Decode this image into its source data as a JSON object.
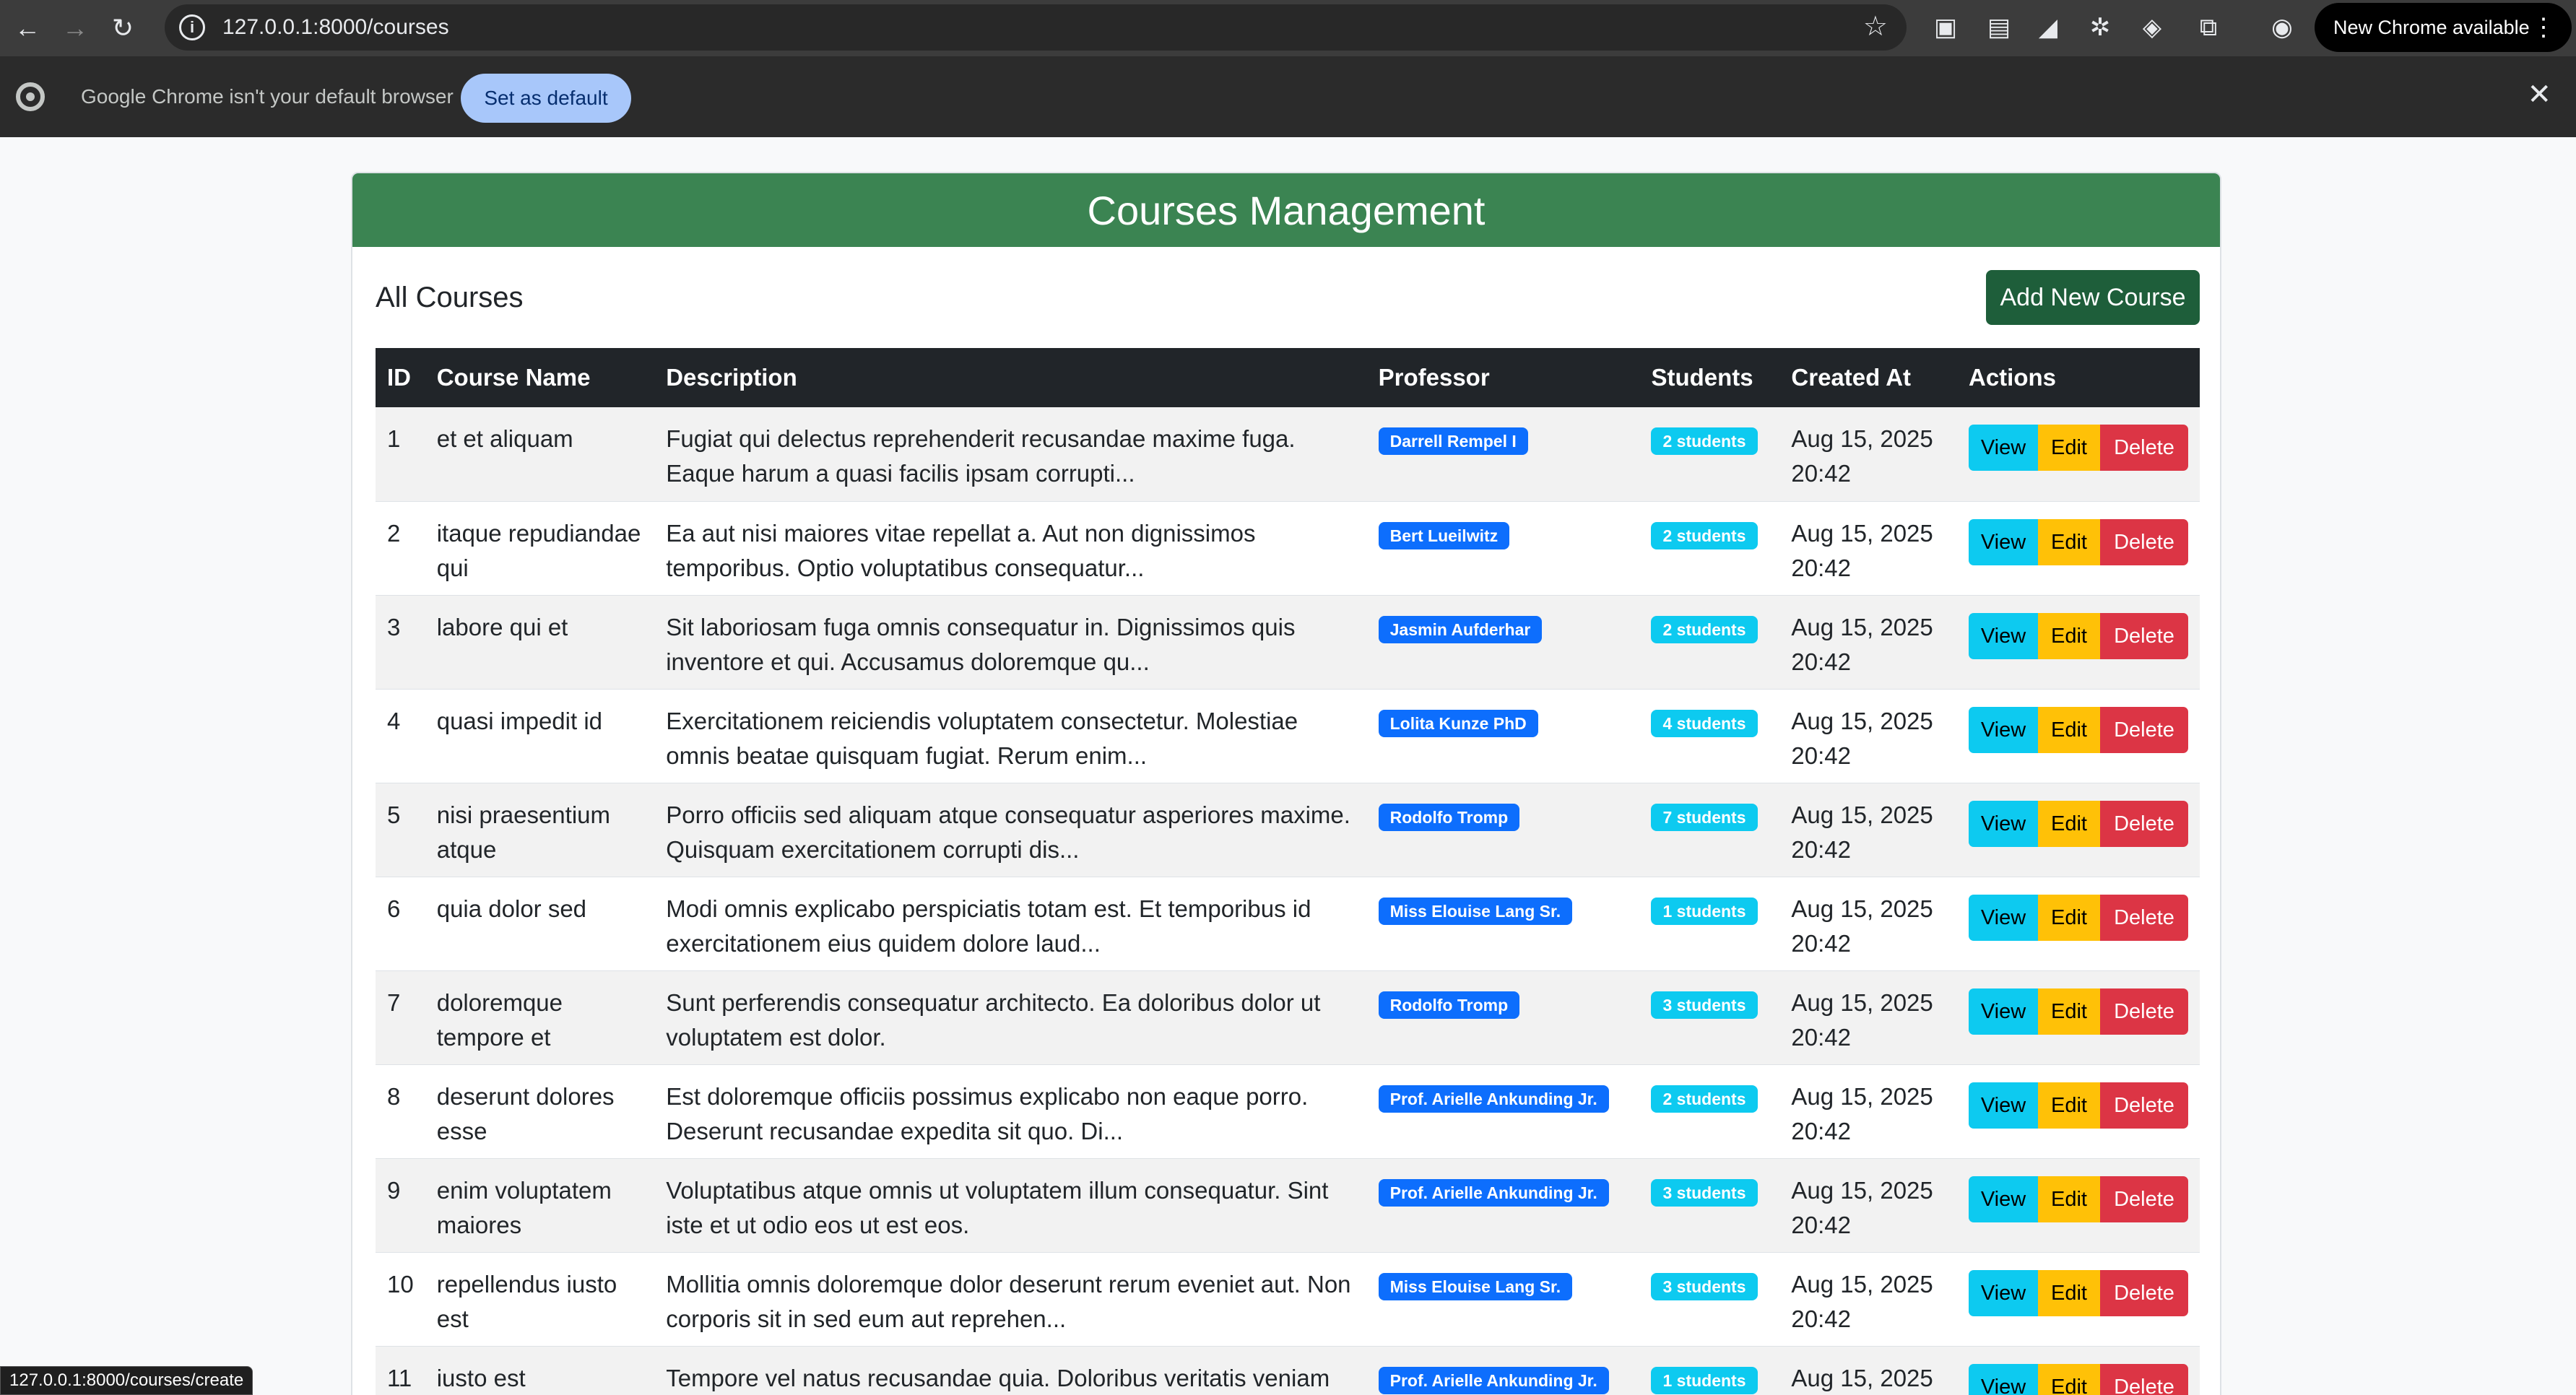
{
  "browser": {
    "url": "127.0.0.1:8000/courses",
    "new_chrome_label": "New Chrome available",
    "status_url": "127.0.0.1:8000/courses/create"
  },
  "infobar": {
    "message": "Google Chrome isn't your default browser",
    "button_label": "Set as default"
  },
  "page": {
    "title": "Courses Management",
    "section_title": "All Courses",
    "add_button": "Add New Course"
  },
  "table": {
    "headers": [
      "ID",
      "Course Name",
      "Description",
      "Professor",
      "Students",
      "Created At",
      "Actions"
    ],
    "action_labels": {
      "view": "View",
      "edit": "Edit",
      "delete": "Delete"
    },
    "rows": [
      {
        "id": "1",
        "name": "et et aliquam",
        "description": "Fugiat qui delectus reprehenderit recusandae maxime fuga. Eaque harum a quasi facilis ipsam corrupti...",
        "professor": "Darrell Rempel I",
        "students": "2 students",
        "created": "Aug 15, 2025 20:42"
      },
      {
        "id": "2",
        "name": "itaque repudiandae qui",
        "description": "Ea aut nisi maiores vitae repellat a. Aut non dignissimos temporibus. Optio voluptatibus consequatur...",
        "professor": "Bert Lueilwitz",
        "students": "2 students",
        "created": "Aug 15, 2025 20:42"
      },
      {
        "id": "3",
        "name": "labore qui et",
        "description": "Sit laboriosam fuga omnis consequatur in. Dignissimos quis inventore et qui. Accusamus doloremque qu...",
        "professor": "Jasmin Aufderhar",
        "students": "2 students",
        "created": "Aug 15, 2025 20:42"
      },
      {
        "id": "4",
        "name": "quasi impedit id",
        "description": "Exercitationem reiciendis voluptatem consectetur. Molestiae omnis beatae quisquam fugiat. Rerum enim...",
        "professor": "Lolita Kunze PhD",
        "students": "4 students",
        "created": "Aug 15, 2025 20:42"
      },
      {
        "id": "5",
        "name": "nisi praesentium atque",
        "description": "Porro officiis sed aliquam atque consequatur asperiores maxime. Quisquam exercitationem corrupti dis...",
        "professor": "Rodolfo Tromp",
        "students": "7 students",
        "created": "Aug 15, 2025 20:42"
      },
      {
        "id": "6",
        "name": "quia dolor sed",
        "description": "Modi omnis explicabo perspiciatis totam est. Et temporibus id exercitationem eius quidem dolore laud...",
        "professor": "Miss Elouise Lang Sr.",
        "students": "1 students",
        "created": "Aug 15, 2025 20:42"
      },
      {
        "id": "7",
        "name": "doloremque tempore et",
        "description": "Sunt perferendis consequatur architecto. Ea doloribus dolor ut voluptatem est dolor.",
        "professor": "Rodolfo Tromp",
        "students": "3 students",
        "created": "Aug 15, 2025 20:42"
      },
      {
        "id": "8",
        "name": "deserunt dolores esse",
        "description": "Est doloremque officiis possimus explicabo non eaque porro. Deserunt recusandae expedita sit quo. Di...",
        "professor": "Prof. Arielle Ankunding Jr.",
        "students": "2 students",
        "created": "Aug 15, 2025 20:42"
      },
      {
        "id": "9",
        "name": "enim voluptatem maiores",
        "description": "Voluptatibus atque omnis ut voluptatem illum consequatur. Sint iste et ut odio eos ut est eos.",
        "professor": "Prof. Arielle Ankunding Jr.",
        "students": "3 students",
        "created": "Aug 15, 2025 20:42"
      },
      {
        "id": "10",
        "name": "repellendus iusto est",
        "description": "Mollitia omnis doloremque dolor deserunt rerum eveniet aut. Non corporis sit in sed eum aut reprehen...",
        "professor": "Miss Elouise Lang Sr.",
        "students": "3 students",
        "created": "Aug 15, 2025 20:42"
      },
      {
        "id": "11",
        "name": "iusto est",
        "description": "Tempore vel natus recusandae quia. Doloribus veritatis veniam",
        "professor": "Prof. Arielle Ankunding Jr.",
        "students": "1 students",
        "created": "Aug 15, 2025"
      }
    ]
  }
}
